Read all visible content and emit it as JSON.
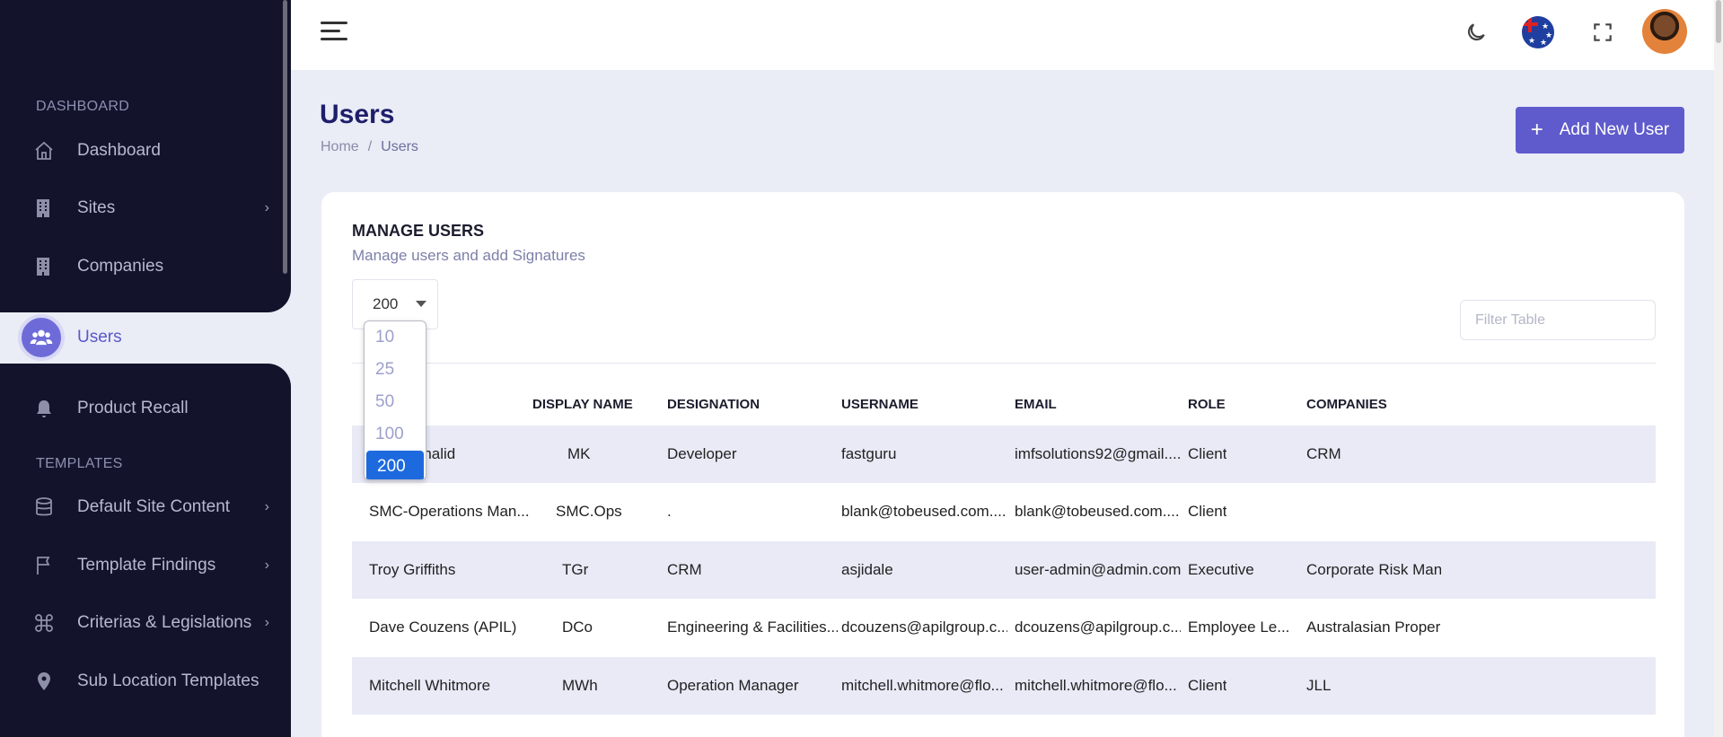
{
  "sidebar": {
    "sections": {
      "dashboard": "DASHBOARD",
      "templates": "TEMPLATES"
    },
    "items": [
      {
        "label": "Dashboard",
        "icon": "home-icon"
      },
      {
        "label": "Sites",
        "icon": "building-icon",
        "chevron": "›"
      },
      {
        "label": "Companies",
        "icon": "building-icon"
      },
      {
        "label": "Users",
        "icon": "users-icon",
        "active": true
      },
      {
        "label": "Product Recall",
        "icon": "bell-icon"
      },
      {
        "label": "Default Site Content",
        "icon": "database-icon",
        "chevron": "›"
      },
      {
        "label": "Template Findings",
        "icon": "flag-icon",
        "chevron": "›"
      },
      {
        "label": "Criterias & Legislations",
        "icon": "command-icon",
        "chevron": "›"
      },
      {
        "label": "Sub Location Templates",
        "icon": "pin-icon"
      }
    ]
  },
  "header": {
    "title": "Users",
    "breadcrumb": {
      "home": "Home",
      "sep": "/",
      "current": "Users"
    },
    "add_button": "Add New User",
    "add_button_icon": "+"
  },
  "card": {
    "title": "MANAGE USERS",
    "subtitle": "Manage users and add Signatures",
    "page_size": "200",
    "page_size_options": [
      "10",
      "25",
      "50",
      "100",
      "200"
    ],
    "filter_placeholder": "Filter Table",
    "columns": [
      "DISPLAY NAME",
      "DESIGNATION",
      "USERNAME",
      "EMAIL",
      "ROLE",
      "COMPANIES"
    ],
    "rows": [
      {
        "name": "Khalid",
        "display": "MK",
        "designation": "Developer",
        "username": "fastguru",
        "email": "imfsolutions92@gmail....",
        "role": "Client",
        "companies": "CRM"
      },
      {
        "name": "SMC-Operations Man...",
        "display": "SMC.Ops",
        "designation": ".",
        "username": "blank@tobeused.com....",
        "email": "blank@tobeused.com....",
        "role": "Client",
        "companies": ""
      },
      {
        "name": "Troy Griffiths",
        "display": "TGr",
        "designation": "CRM",
        "username": "asjidale",
        "email": "user-admin@admin.com",
        "role": "Executive",
        "companies": "Corporate Risk Man"
      },
      {
        "name": "Dave Couzens (APIL)",
        "display": "DCo",
        "designation": "Engineering & Facilities...",
        "username": "dcouzens@apilgroup.c...",
        "email": "dcouzens@apilgroup.c...",
        "role": "Employee Le...",
        "companies": "Australasian Proper"
      },
      {
        "name": "Mitchell Whitmore",
        "display": "MWh",
        "designation": "Operation Manager",
        "username": "mitchell.whitmore@flo...",
        "email": "mitchell.whitmore@flo...",
        "role": "Client",
        "companies": "JLL"
      }
    ]
  },
  "colors": {
    "sidebar_bg": "#13132b",
    "accent": "#5f5bcc",
    "selected_option": "#1d6adf"
  }
}
